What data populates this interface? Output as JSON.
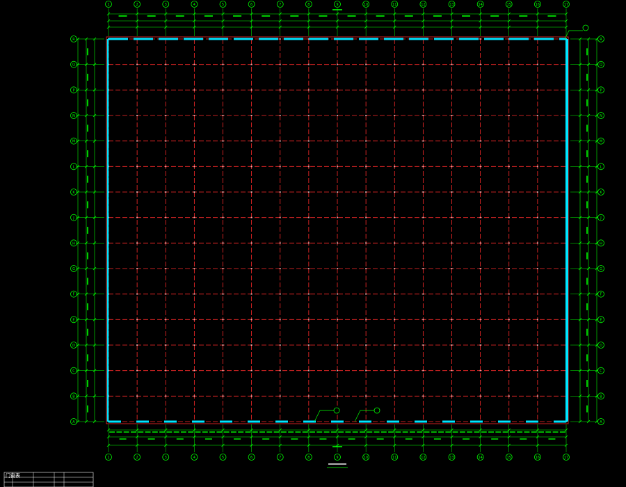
{
  "drawing": {
    "title": "",
    "cols": [
      "1",
      "2",
      "3",
      "4",
      "5",
      "6",
      "7",
      "8",
      "9",
      "10",
      "11",
      "12",
      "13",
      "14",
      "15",
      "16",
      "17"
    ],
    "rows": [
      "A",
      "B",
      "C",
      "D",
      "E",
      "F",
      "G",
      "H",
      "J",
      "K",
      "L",
      "M",
      "N",
      "P",
      "Q",
      "R"
    ],
    "overall_dim": "",
    "top_callout": "",
    "bottom_callouts": [
      "",
      ""
    ]
  },
  "schedule": {
    "title": "门窗表",
    "rows": [
      [
        "",
        "",
        "",
        "",
        ""
      ],
      [
        "",
        "",
        "",
        "",
        ""
      ],
      [
        "",
        "",
        "",
        "",
        ""
      ]
    ]
  },
  "colors": {
    "background": "#000000",
    "grid_line": "#ff2a2a",
    "dimension": "#00ff00",
    "wall": "#00e5ff",
    "text": "#ffffff",
    "callout": "#00ff00"
  }
}
